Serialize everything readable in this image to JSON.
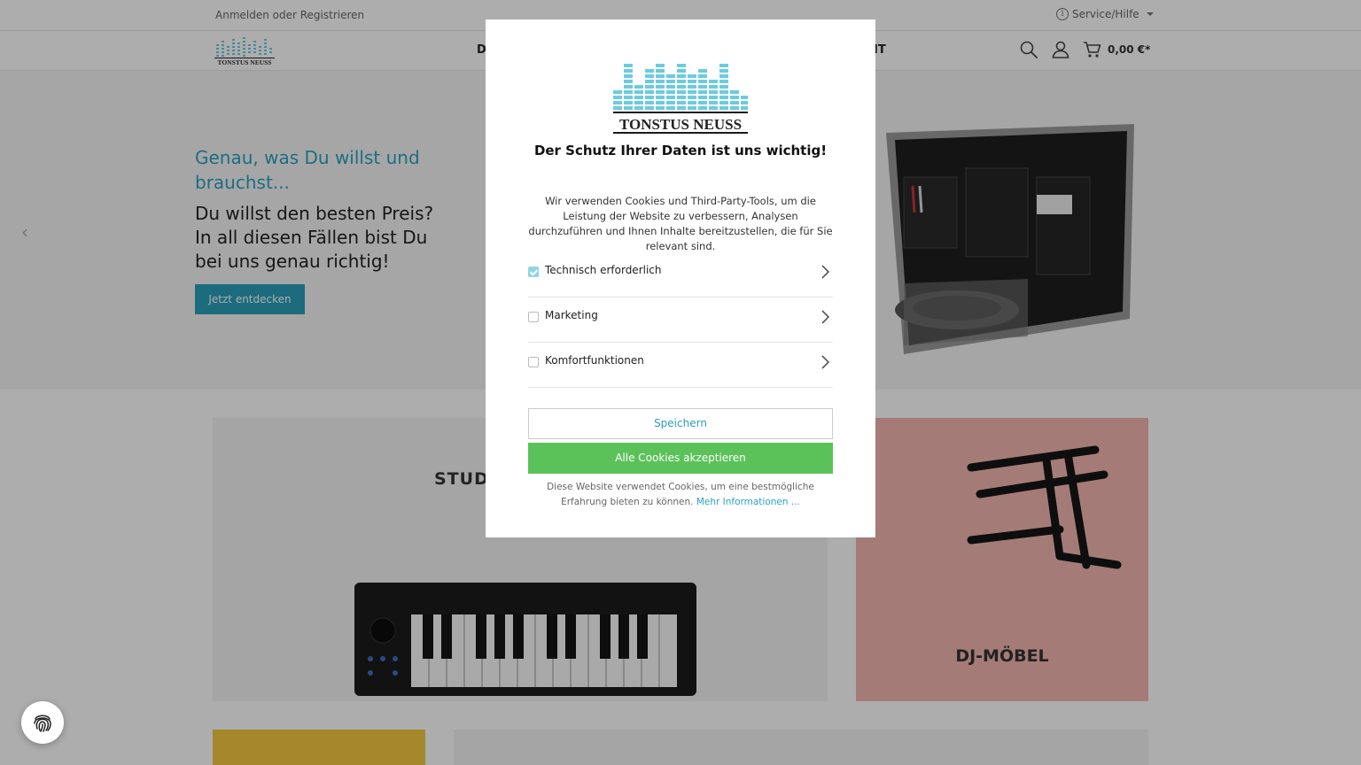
{
  "topbar": {
    "login_link": "Anmelden oder Registrieren",
    "service_menu": "Service/Hilfe"
  },
  "header": {
    "nav_partial_left": "D",
    "nav_partial_right": "IT",
    "cart_total": "0,00 €*",
    "icons": [
      "search-icon",
      "account-icon",
      "cart-icon"
    ]
  },
  "hero": {
    "tagline": "Genau, was Du willst und brauchst...",
    "headline": "Du willst den besten Preis? In all diesen Fällen bist Du bei uns genau richtig!",
    "cta_label": "Jetzt entdecken"
  },
  "tiles": {
    "studio_title_partial": "STUDI",
    "dj_title": "DJ-MÖBEL"
  },
  "cookie_modal": {
    "brand": "TONSTUS NEUSS",
    "title": "Der Schutz Ihrer Daten ist uns wichtig!",
    "description": "Wir verwenden Cookies und Third-Party-Tools, um die Leistung der Website zu verbessern, Analysen durchzuführen und Ihnen Inhalte bereitzustellen, die für Sie relevant sind.",
    "categories": [
      {
        "label": "Technisch erforderlich",
        "checked": true
      },
      {
        "label": "Marketing",
        "checked": false
      },
      {
        "label": "Komfortfunktionen",
        "checked": false
      }
    ],
    "save_label": "Speichern",
    "accept_label": "Alle Cookies akzeptieren",
    "footer_text": "Diese Website verwendet Cookies, um eine bestmögliche Erfahrung bieten zu können.",
    "more_info_label": "Mehr Informationen ..."
  },
  "colors": {
    "accent": "#2aa3bf",
    "accept_green": "#5bc25a",
    "dj_tile": "#f2b5ae"
  }
}
